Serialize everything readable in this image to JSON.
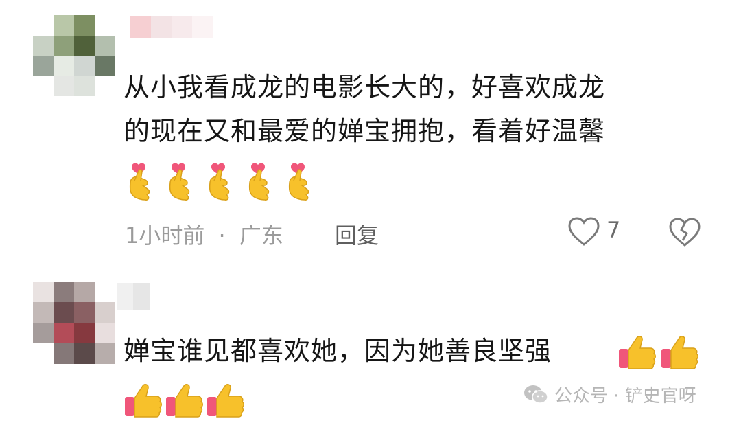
{
  "comments": [
    {
      "text_line1": "从小我看成龙的电影长大的，好喜欢成龙",
      "text_line2": "的现在又和最爱的婵宝拥抱，看着好温馨",
      "emoji": "finger-heart-emoji",
      "emoji_count": 5,
      "time": "1小时前",
      "separator": "·",
      "location": "广东",
      "reply_label": "回复",
      "like_count": "7",
      "icons": [
        "heart-outline-icon",
        "broken-heart-icon"
      ]
    },
    {
      "text_line1": "婵宝谁见都喜欢她，因为她善良坚强",
      "emoji": "thumbs-up-emoji",
      "emoji_count_line1": 2,
      "emoji_count_line2": 3
    }
  ],
  "watermark": {
    "label": "公众号 · 铲史官呀",
    "icon": "wechat-icon"
  },
  "colors": {
    "text": "#161616",
    "meta": "#9b9b9b",
    "emoji_yellow": "#f7c12b",
    "emoji_pink": "#f0567a"
  }
}
